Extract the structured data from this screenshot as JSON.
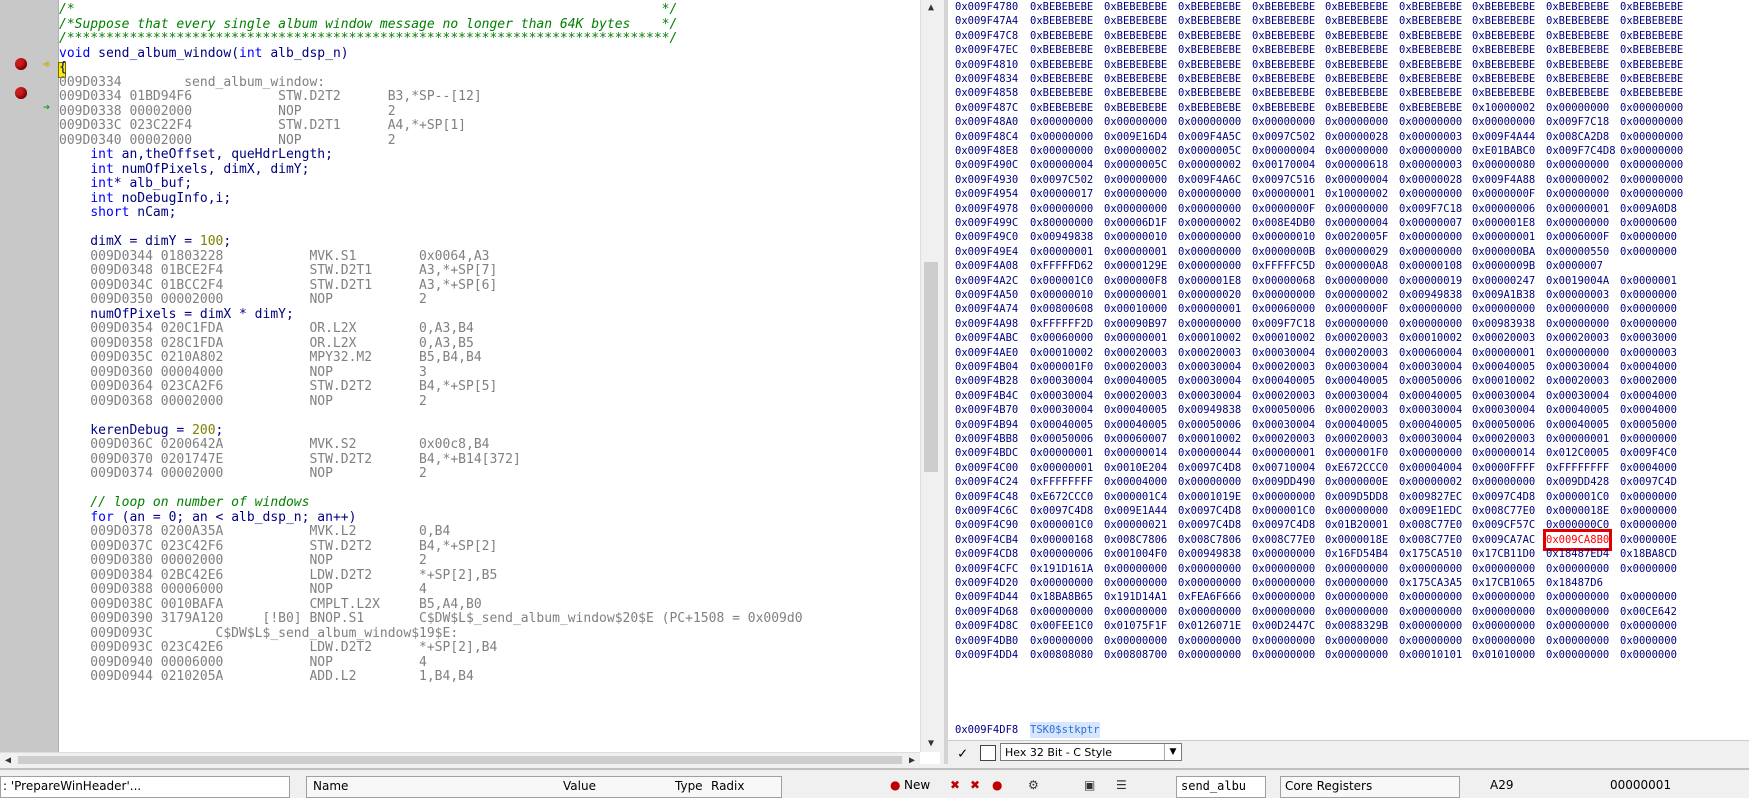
{
  "source": {
    "lines": [
      {
        "t": "comment",
        "s": "/*                                                                           */"
      },
      {
        "t": "comment",
        "s": "/*Suppose that every single album window message no longer than 64K bytes    */"
      },
      {
        "t": "comment",
        "s": "/*****************************************************************************/"
      },
      {
        "t": "code",
        "s": "void send_album_window(int alb_dsp_n)"
      },
      {
        "t": "code",
        "s": "{"
      },
      {
        "t": "asm",
        "s": "009D0334        send_album_window:"
      },
      {
        "t": "asm",
        "s": "009D0334 01BD94F6           STW.D2T2      B3,*SP--[12]"
      },
      {
        "t": "asm",
        "s": "009D0338 00002000           NOP           2"
      },
      {
        "t": "asm",
        "s": "009D033C 023C22F4           STW.D2T1      A4,*+SP[1]"
      },
      {
        "t": "asm",
        "s": "009D0340 00002000           NOP           2"
      },
      {
        "t": "code",
        "s": "    int an,theOffset, queHdrLength;"
      },
      {
        "t": "code",
        "s": "    int numOfPixels, dimX, dimY;"
      },
      {
        "t": "code",
        "s": "    int* alb_buf;"
      },
      {
        "t": "code",
        "s": "    int noDebugInfo,i;"
      },
      {
        "t": "code",
        "s": "    short nCam;"
      },
      {
        "t": "code",
        "s": ""
      },
      {
        "t": "code",
        "s": "    dimX = dimY = 100;"
      },
      {
        "t": "asm",
        "s": "    009D0344 01803228           MVK.S1        0x0064,A3"
      },
      {
        "t": "asm",
        "s": "    009D0348 01BCE2F4           STW.D2T1      A3,*+SP[7]"
      },
      {
        "t": "asm",
        "s": "    009D034C 01BCC2F4           STW.D2T1      A3,*+SP[6]"
      },
      {
        "t": "asm",
        "s": "    009D0350 00002000           NOP           2"
      },
      {
        "t": "code",
        "s": "    numOfPixels = dimX * dimY;"
      },
      {
        "t": "asm",
        "s": "    009D0354 020C1FDA           OR.L2X        0,A3,B4"
      },
      {
        "t": "asm",
        "s": "    009D0358 028C1FDA           OR.L2X        0,A3,B5"
      },
      {
        "t": "asm",
        "s": "    009D035C 0210A802           MPY32.M2      B5,B4,B4"
      },
      {
        "t": "asm",
        "s": "    009D0360 00004000           NOP           3"
      },
      {
        "t": "asm",
        "s": "    009D0364 023CA2F6           STW.D2T2      B4,*+SP[5]"
      },
      {
        "t": "asm",
        "s": "    009D0368 00002000           NOP           2"
      },
      {
        "t": "code",
        "s": ""
      },
      {
        "t": "code",
        "s": "    kerenDebug = 200;"
      },
      {
        "t": "asm",
        "s": "    009D036C 0200642A           MVK.S2        0x00c8,B4"
      },
      {
        "t": "asm",
        "s": "    009D0370 0201747E           STW.D2T2      B4,*+B14[372]"
      },
      {
        "t": "asm",
        "s": "    009D0374 00002000           NOP           2"
      },
      {
        "t": "code",
        "s": ""
      },
      {
        "t": "comment",
        "s": "    // loop on number of windows"
      },
      {
        "t": "code",
        "s": "    for (an = 0; an < alb_dsp_n; an++)"
      },
      {
        "t": "asm",
        "s": "    009D0378 0200A35A           MVK.L2        0,B4"
      },
      {
        "t": "asm",
        "s": "    009D037C 023C42F6           STW.D2T2      B4,*+SP[2]"
      },
      {
        "t": "asm",
        "s": "    009D0380 00002000           NOP           2"
      },
      {
        "t": "asm",
        "s": "    009D0384 02BC42E6           LDW.D2T2      *+SP[2],B5"
      },
      {
        "t": "asm",
        "s": "    009D0388 00006000           NOP           4"
      },
      {
        "t": "asm",
        "s": "    009D038C 0010BAFA           CMPLT.L2X     B5,A4,B0"
      },
      {
        "t": "asm",
        "s": "    009D0390 3179A120     [!B0] BNOP.S1       C$DW$L$_send_album_window$20$E (PC+1508 = 0x009d0"
      },
      {
        "t": "asm",
        "s": "    009D093C        C$DW$L$_send_album_window$19$E:"
      },
      {
        "t": "asm",
        "s": "    009D093C 023C42E6           LDW.D2T2      *+SP[2],B4"
      },
      {
        "t": "asm",
        "s": "    009D0940 00006000           NOP           4"
      },
      {
        "t": "asm",
        "s": "    009D0944 0210205A           ADD.L2        1,B4,B4"
      }
    ]
  },
  "memory": {
    "rows": [
      [
        "0x009F4780",
        "0xBEBEBEBE",
        "0xBEBEBEBE",
        "0xBEBEBEBE",
        "0xBEBEBEBE",
        "0xBEBEBEBE",
        "0xBEBEBEBE",
        "0xBEBEBEBE",
        "0xBEBEBEBE",
        "0xBEBEBEBE"
      ],
      [
        "0x009F47A4",
        "0xBEBEBEBE",
        "0xBEBEBEBE",
        "0xBEBEBEBE",
        "0xBEBEBEBE",
        "0xBEBEBEBE",
        "0xBEBEBEBE",
        "0xBEBEBEBE",
        "0xBEBEBEBE",
        "0xBEBEBEBE"
      ],
      [
        "0x009F47C8",
        "0xBEBEBEBE",
        "0xBEBEBEBE",
        "0xBEBEBEBE",
        "0xBEBEBEBE",
        "0xBEBEBEBE",
        "0xBEBEBEBE",
        "0xBEBEBEBE",
        "0xBEBEBEBE",
        "0xBEBEBEBE"
      ],
      [
        "0x009F47EC",
        "0xBEBEBEBE",
        "0xBEBEBEBE",
        "0xBEBEBEBE",
        "0xBEBEBEBE",
        "0xBEBEBEBE",
        "0xBEBEBEBE",
        "0xBEBEBEBE",
        "0xBEBEBEBE",
        "0xBEBEBEBE"
      ],
      [
        "0x009F4810",
        "0xBEBEBEBE",
        "0xBEBEBEBE",
        "0xBEBEBEBE",
        "0xBEBEBEBE",
        "0xBEBEBEBE",
        "0xBEBEBEBE",
        "0xBEBEBEBE",
        "0xBEBEBEBE",
        "0xBEBEBEBE"
      ],
      [
        "0x009F4834",
        "0xBEBEBEBE",
        "0xBEBEBEBE",
        "0xBEBEBEBE",
        "0xBEBEBEBE",
        "0xBEBEBEBE",
        "0xBEBEBEBE",
        "0xBEBEBEBE",
        "0xBEBEBEBE",
        "0xBEBEBEBE"
      ],
      [
        "0x009F4858",
        "0xBEBEBEBE",
        "0xBEBEBEBE",
        "0xBEBEBEBE",
        "0xBEBEBEBE",
        "0xBEBEBEBE",
        "0xBEBEBEBE",
        "0xBEBEBEBE",
        "0xBEBEBEBE",
        "0xBEBEBEBE"
      ],
      [
        "0x009F487C",
        "0xBEBEBEBE",
        "0xBEBEBEBE",
        "0xBEBEBEBE",
        "0xBEBEBEBE",
        "0xBEBEBEBE",
        "0xBEBEBEBE",
        "0x10000002",
        "0x00000000",
        "0x00000000"
      ],
      [
        "0x009F48A0",
        "0x00000000",
        "0x00000000",
        "0x00000000",
        "0x00000000",
        "0x00000000",
        "0x00000000",
        "0x00000000",
        "0x009F7C18",
        "0x00000000"
      ],
      [
        "0x009F48C4",
        "0x00000000",
        "0x009E16D4",
        "0x009F4A5C",
        "0x0097C502",
        "0x00000028",
        "0x00000003",
        "0x009F4A44",
        "0x008CA2D8",
        "0x00000000"
      ],
      [
        "0x009F48E8",
        "0x00000000",
        "0x00000002",
        "0x0000005C",
        "0x00000004",
        "0x00000000",
        "0x00000000",
        "0xE01BABC0",
        "0x009F7C4D8",
        "0x00000000"
      ],
      [
        "0x009F490C",
        "0x00000004",
        "0x0000005C",
        "0x00000002",
        "0x00170004",
        "0x00000618",
        "0x00000003",
        "0x00000080",
        "0x00000000",
        "0x00000000"
      ],
      [
        "0x009F4930",
        "0x0097C502",
        "0x00000000",
        "0x009F4A6C",
        "0x0097C516",
        "0x00000004",
        "0x00000028",
        "0x009F4A88",
        "0x00000002",
        "0x00000000"
      ],
      [
        "0x009F4954",
        "0x00000017",
        "0x00000000",
        "0x00000000",
        "0x00000001",
        "0x10000002",
        "0x00000000",
        "0x0000000F",
        "0x00000000",
        "0x00000000"
      ],
      [
        "0x009F4978",
        "0x00000000",
        "0x00000000",
        "0x00000000",
        "0x0000000F",
        "0x00000000",
        "0x009F7C18",
        "0x00000006",
        "0x00000001",
        "0x009A0D8"
      ],
      [
        "0x009F499C",
        "0x80000000",
        "0x00006D1F",
        "0x00000002",
        "0x008E4DB0",
        "0x00000004",
        "0x00000007",
        "0x000001E8",
        "0x00000000",
        "0x0000600"
      ],
      [
        "0x009F49C0",
        "0x00949838",
        "0x00000010",
        "0x00000000",
        "0x00000010",
        "0x0020005F",
        "0x00000000",
        "0x00000001",
        "0x0006000F",
        "0x0000000"
      ],
      [
        "0x009F49E4",
        "0x00000001",
        "0x00000001",
        "0x00000000",
        "0x0000000B",
        "0x00000029",
        "0x00000000",
        "0x000000BA",
        "0x00000550",
        "0x0000000"
      ],
      [
        "0x009F4A08",
        "0xFFFFFD62",
        "0x0000129E",
        "0x00000000",
        "0xFFFFFC5D",
        "0x000000A8",
        "0x00000108",
        "0x0000009B",
        "0x0000007"
      ],
      [
        "0x009F4A2C",
        "0x000001C0",
        "0x000000F8",
        "0x000001E8",
        "0x00000068",
        "0x00000000",
        "0x00000019",
        "0x00000247",
        "0x0019004A",
        "0x0000001"
      ],
      [
        "0x009F4A50",
        "0x00000010",
        "0x00000001",
        "0x00000020",
        "0x00000000",
        "0x00000002",
        "0x00949838",
        "0x009A1B38",
        "0x00000003",
        "0x0000000"
      ],
      [
        "0x009F4A74",
        "0x00800608",
        "0x00010000",
        "0x00000001",
        "0x00060000",
        "0x0000000F",
        "0x00000000",
        "0x00000000",
        "0x00000000",
        "0x0000000"
      ],
      [
        "0x009F4A98",
        "0xFFFFFF2D",
        "0x00090B97",
        "0x00000000",
        "0x009F7C18",
        "0x00000000",
        "0x00000000",
        "0x00983938",
        "0x00000000",
        "0x0000000"
      ],
      [
        "0x009F4ABC",
        "0x00060000",
        "0x00000001",
        "0x00010002",
        "0x00010002",
        "0x00020003",
        "0x00010002",
        "0x00020003",
        "0x00020003",
        "0x0003000"
      ],
      [
        "0x009F4AE0",
        "0x00010002",
        "0x00020003",
        "0x00020003",
        "0x00030004",
        "0x00020003",
        "0x00060004",
        "0x00000001",
        "0x00000000",
        "0x0000003"
      ],
      [
        "0x009F4B04",
        "0x000001F0",
        "0x00020003",
        "0x00030004",
        "0x00020003",
        "0x00030004",
        "0x00030004",
        "0x00040005",
        "0x00030004",
        "0x0004000"
      ],
      [
        "0x009F4B28",
        "0x00030004",
        "0x00040005",
        "0x00030004",
        "0x00040005",
        "0x00040005",
        "0x00050006",
        "0x00010002",
        "0x00020003",
        "0x0002000"
      ],
      [
        "0x009F4B4C",
        "0x00030004",
        "0x00020003",
        "0x00030004",
        "0x00020003",
        "0x00030004",
        "0x00040005",
        "0x00030004",
        "0x00030004",
        "0x0004000"
      ],
      [
        "0x009F4B70",
        "0x00030004",
        "0x00040005",
        "0x00949838",
        "0x00050006",
        "0x00020003",
        "0x00030004",
        "0x00030004",
        "0x00040005",
        "0x0004000"
      ],
      [
        "0x009F4B94",
        "0x00040005",
        "0x00040005",
        "0x00050006",
        "0x00030004",
        "0x00040005",
        "0x00040005",
        "0x00050006",
        "0x00040005",
        "0x0005000"
      ],
      [
        "0x009F4BB8",
        "0x00050006",
        "0x00060007",
        "0x00010002",
        "0x00020003",
        "0x00020003",
        "0x00030004",
        "0x00020003",
        "0x00000001",
        "0x0000000"
      ],
      [
        "0x009F4BDC",
        "0x00000001",
        "0x00000014",
        "0x00000044",
        "0x00000001",
        "0x000001F0",
        "0x00000000",
        "0x00000014",
        "0x012C0005",
        "0x009F4C0"
      ],
      [
        "0x009F4C00",
        "0x00000001",
        "0x0010E204",
        "0x0097C4D8",
        "0x00710004",
        "0xE672CCC0",
        "0x00004004",
        "0x0000FFFF",
        "0xFFFFFFFF",
        "0x0004000"
      ],
      [
        "0x009F4C24",
        "0xFFFFFFFF",
        "0x00004000",
        "0x00000000",
        "0x009DD490",
        "0x0000000E",
        "0x00000002",
        "0x00000000",
        "0x009DD428",
        "0x0097C4D"
      ],
      [
        "0x009F4C48",
        "0xE672CCC0",
        "0x000001C4",
        "0x0001019E",
        "0x00000000",
        "0x009D5DD8",
        "0x009827EC",
        "0x0097C4D8",
        "0x000001C0",
        "0x0000000"
      ],
      [
        "0x009F4C6C",
        "0x0097C4D8",
        "0x009E1A44",
        "0x0097C4D8",
        "0x000001C0",
        "0x00000000",
        "0x009E1EDC",
        "0x008C77E0",
        "0x0000018E",
        "0x0000000"
      ],
      [
        "0x009F4C90",
        "0x000001C0",
        "0x00000021",
        "0x0097C4D8",
        "0x0097C4D8",
        "0x01B20001",
        "0x008C77E0",
        "0x009CF57C",
        "0x000000C0",
        "0x0000000"
      ],
      [
        "0x009F4CB4",
        "0x00000168",
        "0x008C7806",
        "0x008C7806",
        "0x008C77E0",
        "0x0000018E",
        "0x008C77E0",
        "0x009CA7AC",
        "0x009CA8B0",
        "0x000000E"
      ],
      [
        "0x009F4CD8",
        "0x00000006",
        "0x001004F0",
        "0x00949838",
        "0x00000000",
        "0x16FD54B4",
        "0x175CA510",
        "0x17CB11D0",
        "0x18487ED4",
        "0x18BA8CD"
      ],
      [
        "0x009F4CFC",
        "0x191D161A",
        "0x00000000",
        "0x00000000",
        "0x00000000",
        "0x00000000",
        "0x00000000",
        "0x00000000",
        "0x00000000",
        "0x0000000"
      ],
      [
        "0x009F4D20",
        "0x00000000",
        "0x00000000",
        "0x00000000",
        "0x00000000",
        "0x00000000",
        "0x175CA3A5",
        "0x17CB1065",
        "0x18487D6"
      ],
      [
        "0x009F4D44",
        "0x18BA8B65",
        "0x191D14A1",
        "0xFEA6F666",
        "0x00000000",
        "0x00000000",
        "0x00000000",
        "0x00000000",
        "0x00000000",
        "0x0000000"
      ],
      [
        "0x009F4D68",
        "0x00000000",
        "0x00000000",
        "0x00000000",
        "0x00000000",
        "0x00000000",
        "0x00000000",
        "0x00000000",
        "0x00000000",
        "0x00CE642"
      ],
      [
        "0x009F4D8C",
        "0x00FEE1C0",
        "0x01075F1F",
        "0x0126071E",
        "0x00D2447C",
        "0x0088329B",
        "0x00000000",
        "0x00000000",
        "0x00000000",
        "0x0000000"
      ],
      [
        "0x009F4DB0",
        "0x00000000",
        "0x00000000",
        "0x00000000",
        "0x00000000",
        "0x00000000",
        "0x00000000",
        "0x00000000",
        "0x00000000",
        "0x0000000"
      ],
      [
        "0x009F4DD4",
        "0x00808080",
        "0x00808700",
        "0x00000000",
        "0x00000000",
        "0x00000000",
        "0x00010101",
        "0x01010000",
        "0x00000000",
        "0x0000000"
      ]
    ],
    "highlight": {
      "row": 37,
      "col": 8
    },
    "format": "Hex 32 Bit - C Style",
    "next_addr": "0x009F4DF8",
    "next_symbol": "TSK0$stkptr"
  },
  "bottom": {
    "callstack_item": ": 'PrepareWinHeader'...",
    "col_name": "Name",
    "col_value": "Value",
    "col_type": "Type",
    "col_radix": "Radix",
    "new_label": "New",
    "search_value": "send_albu",
    "registers_label": "Core Registers",
    "reg_name": "A29",
    "reg_value": "00000001"
  },
  "colors": {
    "accent_red": "#e00000",
    "code_blue": "#000080",
    "comment_green": "#008000",
    "asm_gray": "#808080"
  }
}
